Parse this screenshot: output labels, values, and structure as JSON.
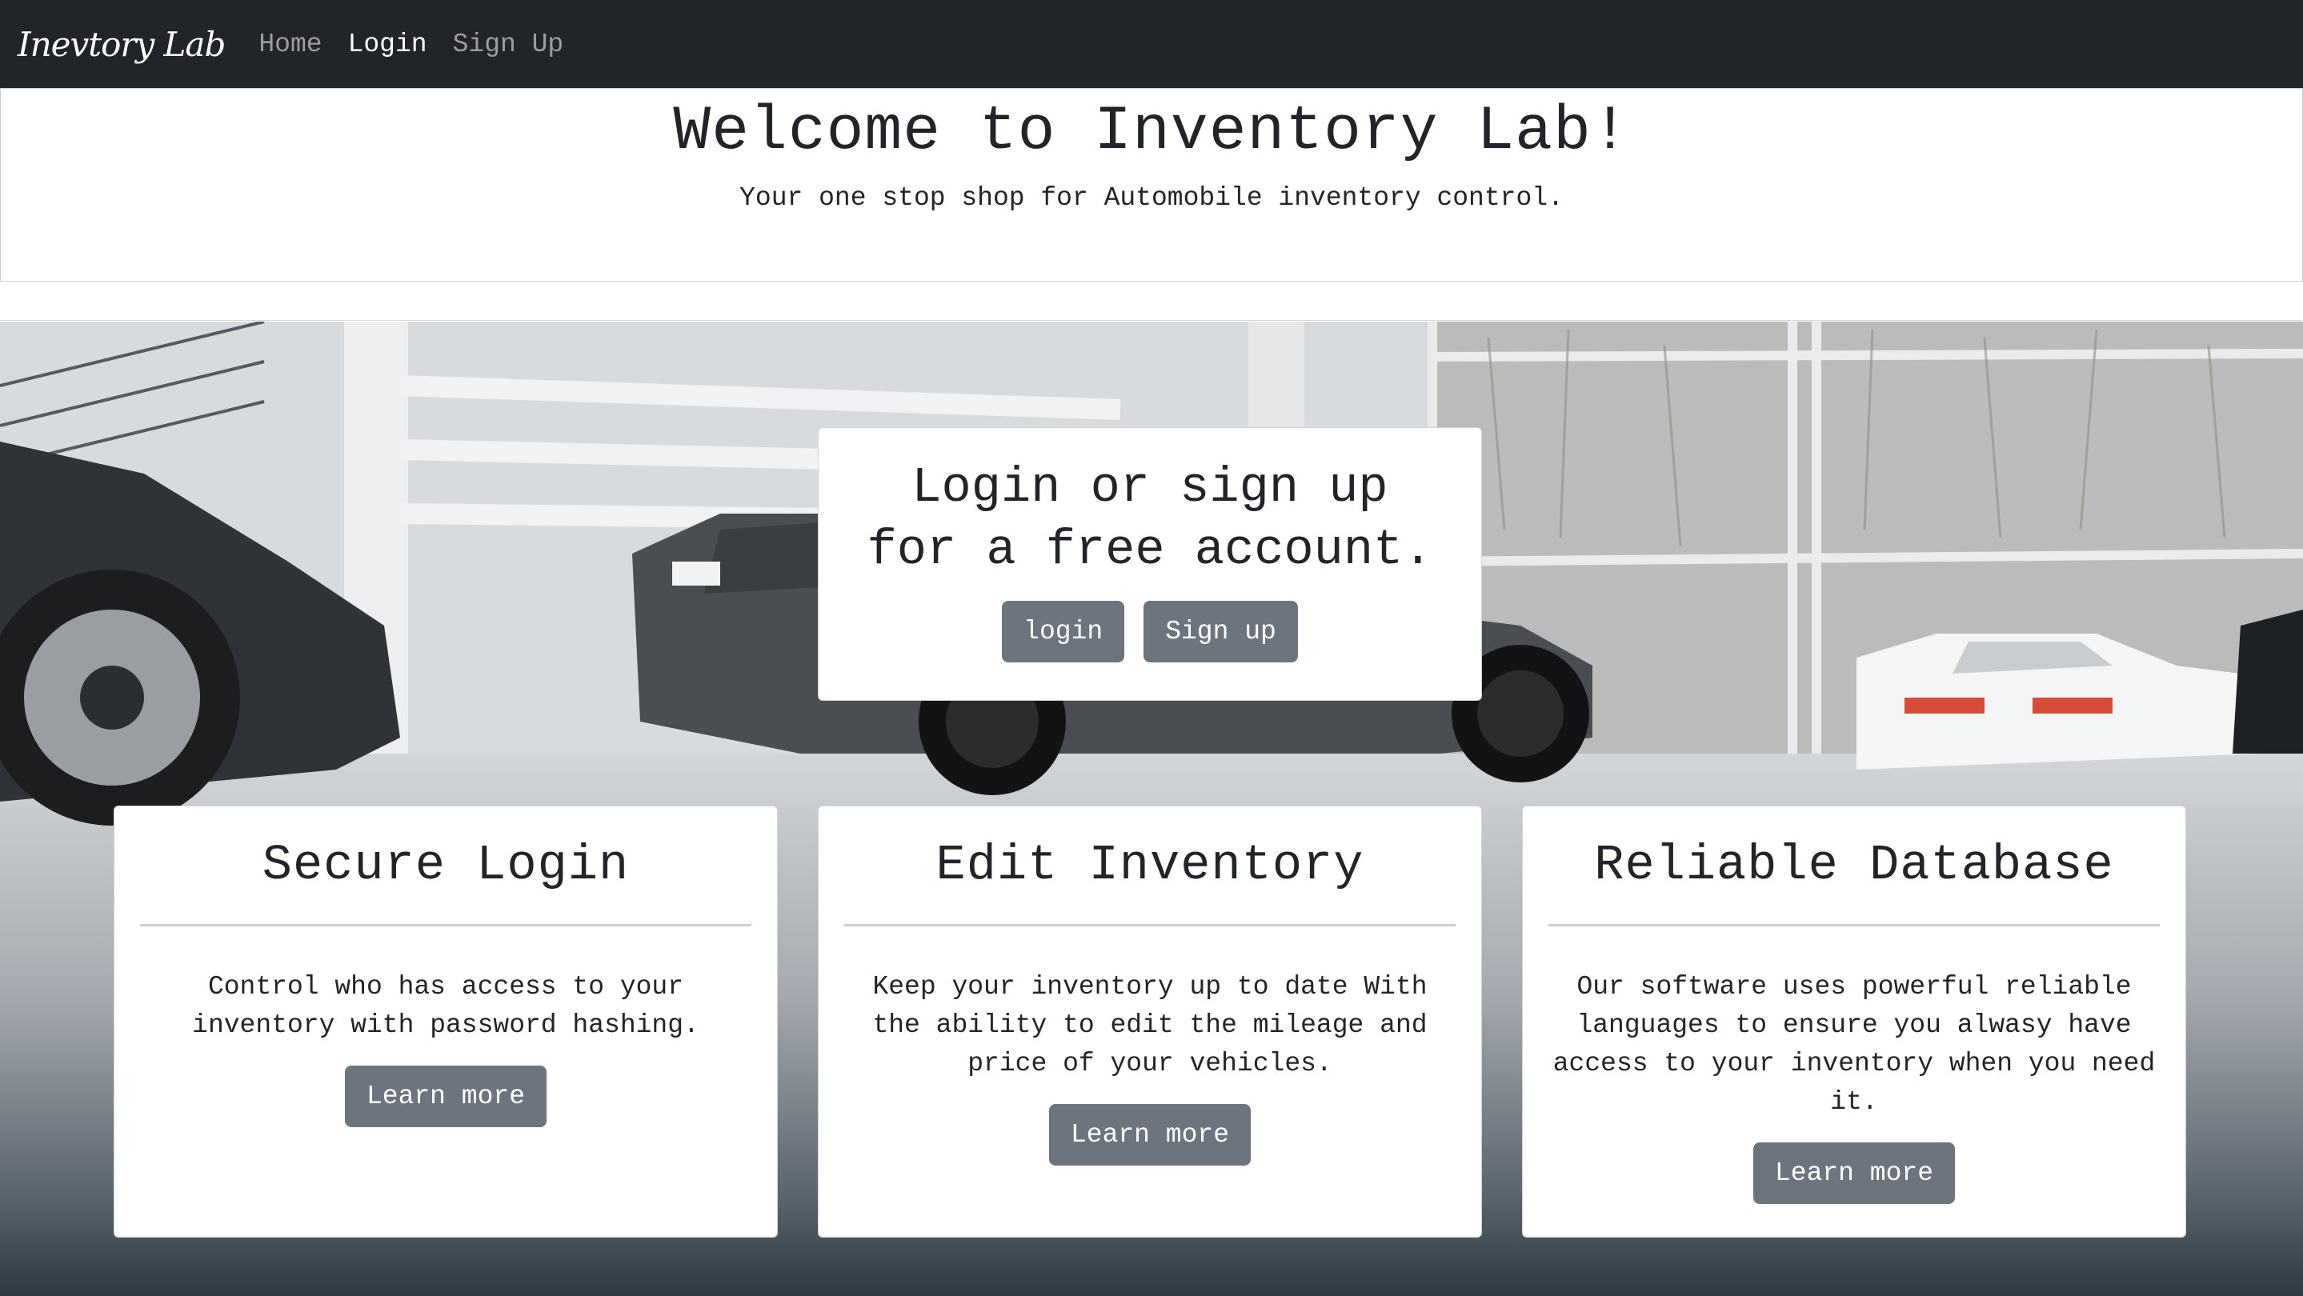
{
  "navbar": {
    "brand": "Inevtory Lab",
    "links": [
      {
        "label": "Home",
        "active": false
      },
      {
        "label": "Login",
        "active": true
      },
      {
        "label": "Sign Up",
        "active": false
      }
    ]
  },
  "header": {
    "title": "Welcome to Inventory Lab!",
    "subtitle": "Your one stop shop for Automobile inventory control."
  },
  "hero_card": {
    "heading_line1": "Login or sign up",
    "heading_line2": "for a free account.",
    "login_label": "login",
    "signup_label": "Sign up"
  },
  "features": [
    {
      "title": "Secure Login",
      "text": "Control who has access to your inventory with password hashing.",
      "button": "Learn more"
    },
    {
      "title": "Edit Inventory",
      "text": "Keep your inventory up to date With the ability to edit the mileage and price of your vehicles.",
      "button": "Learn more"
    },
    {
      "title": "Reliable Database",
      "text": "Our software uses powerful reliable languages to ensure you alwasy have access to your inventory when you need it.",
      "button": "Learn more"
    }
  ],
  "colors": {
    "navbar_bg": "#212529",
    "button_bg": "#6c757d",
    "card_bg": "#ffffff"
  }
}
